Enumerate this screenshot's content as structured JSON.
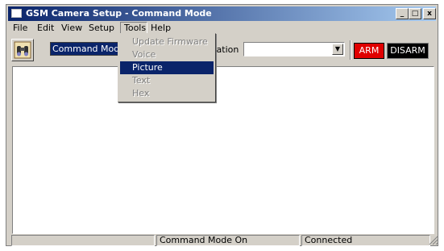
{
  "window": {
    "title": "GSM Camera Setup - Command Mode",
    "controls": {
      "minimize": "_",
      "maximize": "□",
      "close": "x"
    }
  },
  "menubar": {
    "items": [
      {
        "label": "File"
      },
      {
        "label": "Edit"
      },
      {
        "label": "View"
      },
      {
        "label": "Setup"
      },
      {
        "label": "Tools"
      },
      {
        "label": "Help"
      }
    ]
  },
  "tools_menu": {
    "items": [
      {
        "label": "Update Firmware",
        "enabled": false
      },
      {
        "label": "Voice",
        "enabled": false
      },
      {
        "label": "Picture",
        "enabled": true,
        "highlighted": true
      },
      {
        "label": "Text",
        "enabled": false
      },
      {
        "label": "Hex",
        "enabled": false
      }
    ]
  },
  "toolbar": {
    "mode_value": "Command Mode",
    "config_label_visible": "ration",
    "config_value": "",
    "arm_label": "ARM",
    "disarm_label": "DISARM",
    "camera_icon": "binoculars-icon"
  },
  "status": {
    "panel1": "",
    "panel2": "Command Mode On",
    "panel3": "Connected"
  },
  "colors": {
    "titlebar_start": "#0a246a",
    "titlebar_end": "#a6caf0",
    "arm": "#e00000",
    "disarm": "#000000",
    "highlight": "#0a246a"
  }
}
